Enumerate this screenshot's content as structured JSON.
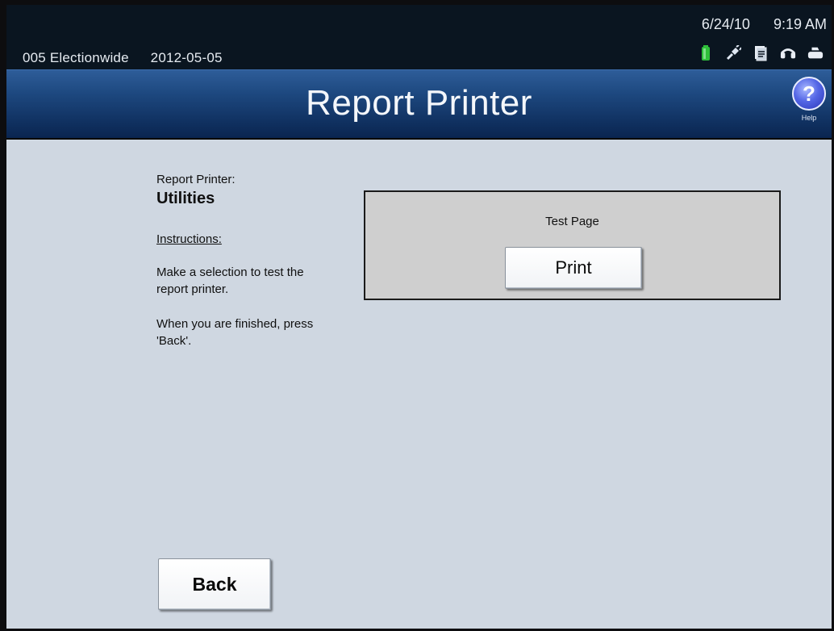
{
  "status_bar": {
    "election_name": "005 Electionwide",
    "election_date": "2012-05-05",
    "date": "6/24/10",
    "time": "9:19 AM",
    "status_icons": [
      "battery-icon",
      "power-plug-icon",
      "document-icon",
      "headset-icon",
      "printer-icon"
    ]
  },
  "header": {
    "title": "Report Printer",
    "help_label": "Help"
  },
  "sidebar": {
    "breadcrumb": "Report Printer:",
    "section_title": "Utilities",
    "instructions_heading": "Instructions:",
    "instruction_1": "Make a selection to test the report printer.",
    "instruction_2": "When you are finished, press 'Back'."
  },
  "test_page_panel": {
    "title": "Test Page",
    "print_label": "Print"
  },
  "footer": {
    "back_label": "Back"
  },
  "colors": {
    "status_bar_bg": "#0a1520",
    "title_bar_blue": "#1d487f",
    "content_bg": "#cfd7e1",
    "panel_bg": "#cfcfcf",
    "battery_green": "#2fbf3a"
  }
}
